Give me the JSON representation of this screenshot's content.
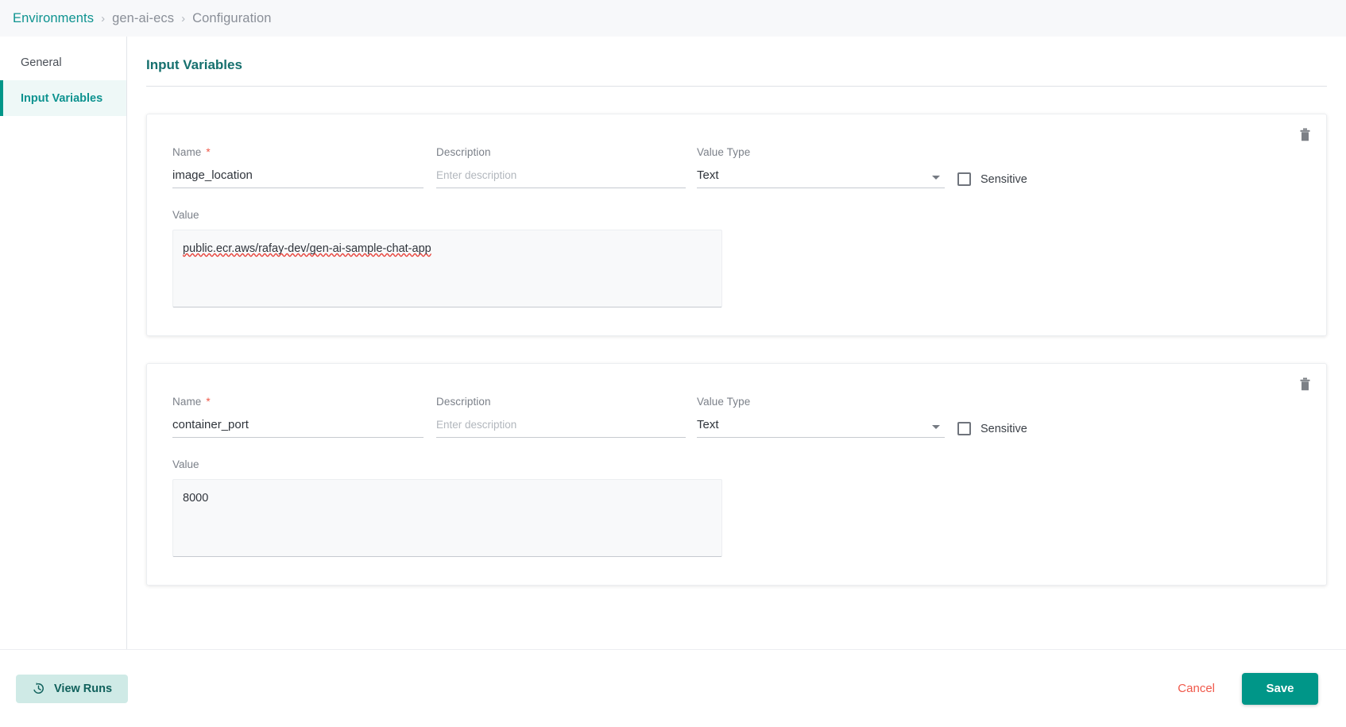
{
  "breadcrumb": {
    "root": "Environments",
    "separator": "›",
    "middle": "gen-ai-ecs",
    "current": "Configuration"
  },
  "sidebar": {
    "items": [
      {
        "label": "General",
        "active": false
      },
      {
        "label": "Input Variables",
        "active": true
      }
    ]
  },
  "main": {
    "title": "Input Variables"
  },
  "labels": {
    "name": "Name",
    "required_star": "*",
    "description": "Description",
    "value_type": "Value Type",
    "sensitive": "Sensitive",
    "value": "Value",
    "description_placeholder": "Enter description"
  },
  "variables": [
    {
      "name": "image_location",
      "description": "",
      "value_type": "Text",
      "sensitive": false,
      "value": "public.ecr.aws/rafay-dev/gen-ai-sample-chat-app"
    },
    {
      "name": "container_port",
      "description": "",
      "value_type": "Text",
      "sensitive": false,
      "value": "8000"
    }
  ],
  "footer": {
    "view_runs": "View Runs",
    "cancel": "Cancel",
    "save": "Save"
  },
  "colors": {
    "accent": "#009688",
    "accent_dark": "#16706e",
    "danger": "#f0584a",
    "muted": "#7b8089"
  }
}
